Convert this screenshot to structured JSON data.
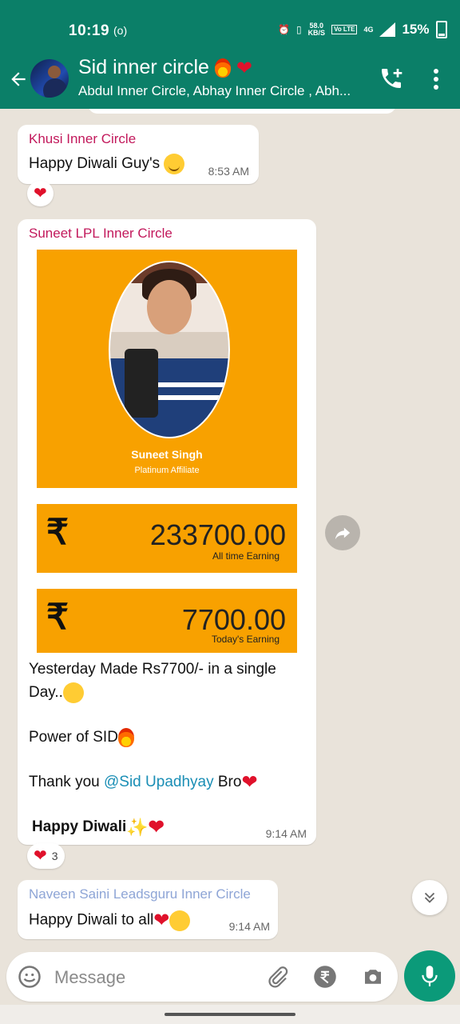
{
  "status_bar": {
    "time": "10:19",
    "speed_value": "58.0",
    "speed_unit": "KB/S",
    "volte": "Vo LTE",
    "network": "4G",
    "battery": "15%"
  },
  "header": {
    "title": "Sid inner circle",
    "subtitle": "Abdul Inner Circle, Abhay Inner Circle , Abh..."
  },
  "messages": [
    {
      "sender": "Khusi Inner Circle",
      "sender_color": "#c2185b",
      "text": "Happy Diwali Guy's",
      "time": "8:53 AM",
      "reaction_count": ""
    },
    {
      "sender": "Suneet LPL Inner Circle",
      "sender_color": "#c2185b",
      "card": {
        "name": "Suneet Singh",
        "role": "Platinum Affiliate",
        "currency_symbol": "₹",
        "all_time_amount": "233700.00",
        "all_time_label": "All time Earning",
        "today_amount": "7700.00",
        "today_label": "Today's Earning"
      },
      "line1": "Yesterday Made Rs7700/- in a single",
      "line2": "Day..",
      "line3": "Power of SID",
      "line4_prefix": "Thank you ",
      "mention": "@Sid Upadhyay",
      "line4_suffix": " Bro",
      "line5": "Happy Diwali",
      "time": "9:14 AM",
      "reaction_count": "3"
    },
    {
      "sender": "Naveen Saini Leadsguru Inner Circle",
      "sender_color": "#8ea5d6",
      "text": "Happy Diwali to all",
      "time": "9:14 AM"
    }
  ],
  "composer": {
    "placeholder": "Message"
  },
  "colors": {
    "header_bg": "#0b7f68",
    "accent": "#0b9a79",
    "card_orange": "#f8a100"
  },
  "icons": [
    "back-arrow-icon",
    "add-call-icon",
    "more-options-icon",
    "emoji-icon",
    "attach-icon",
    "rupee-payment-icon",
    "camera-icon",
    "mic-icon",
    "forward-icon",
    "chevron-down-icon"
  ]
}
